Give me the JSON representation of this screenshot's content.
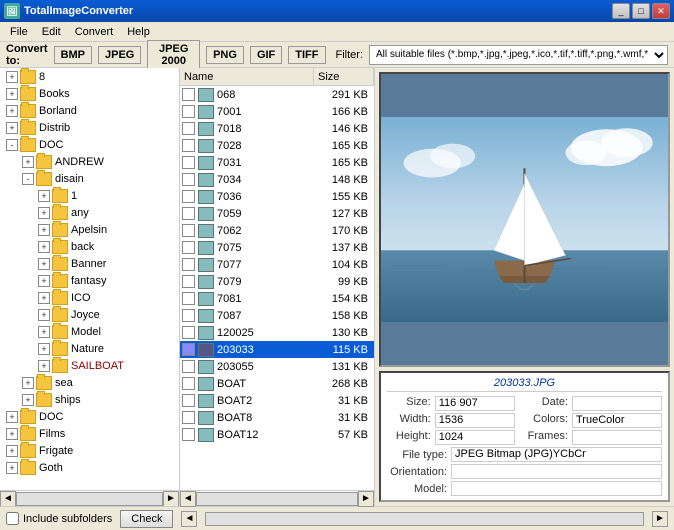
{
  "app": {
    "title": "TotalImageConverter",
    "icon": "🖼"
  },
  "title_buttons": {
    "minimize": "_",
    "maximize": "□",
    "close": "✕"
  },
  "menu": {
    "items": [
      "File",
      "Edit",
      "Convert",
      "Help"
    ]
  },
  "toolbar": {
    "convert_label": "Convert to:",
    "formats": [
      "BMP",
      "JPEG",
      "JPEG 2000",
      "PNG",
      "GIF",
      "TIFF"
    ],
    "filter_label": "Filter:",
    "filter_value": "All suitable files (*.bmp,*.jpg,*.jpeg,*.ico,*.tif,*.tiff,*.png,*.wmf,*"
  },
  "folder_tree": {
    "items": [
      {
        "label": "8",
        "indent": 0,
        "expanded": false
      },
      {
        "label": "Books",
        "indent": 0,
        "expanded": false
      },
      {
        "label": "Borland",
        "indent": 0,
        "expanded": false
      },
      {
        "label": "Distrib",
        "indent": 0,
        "expanded": false
      },
      {
        "label": "DOC",
        "indent": 0,
        "expanded": true
      },
      {
        "label": "ANDREW",
        "indent": 1,
        "expanded": false
      },
      {
        "label": "disain",
        "indent": 1,
        "expanded": true
      },
      {
        "label": "1",
        "indent": 2,
        "expanded": false
      },
      {
        "label": "any",
        "indent": 2,
        "expanded": false
      },
      {
        "label": "Apelsin",
        "indent": 2,
        "expanded": false
      },
      {
        "label": "back",
        "indent": 2,
        "expanded": false
      },
      {
        "label": "Banner",
        "indent": 2,
        "expanded": false
      },
      {
        "label": "fantasy",
        "indent": 2,
        "expanded": false
      },
      {
        "label": "ICO",
        "indent": 2,
        "expanded": false
      },
      {
        "label": "Joyce",
        "indent": 2,
        "expanded": false
      },
      {
        "label": "Model",
        "indent": 2,
        "expanded": false
      },
      {
        "label": "Nature",
        "indent": 2,
        "expanded": false
      },
      {
        "label": "SAILBOAT",
        "indent": 2,
        "expanded": false,
        "selected": false
      },
      {
        "label": "sea",
        "indent": 1,
        "expanded": false
      },
      {
        "label": "ships",
        "indent": 1,
        "expanded": false
      },
      {
        "label": "DOC",
        "indent": 0,
        "expanded": false
      },
      {
        "label": "Films",
        "indent": 0,
        "expanded": false
      },
      {
        "label": "Frigate",
        "indent": 0,
        "expanded": false
      },
      {
        "label": "Goth",
        "indent": 0,
        "expanded": false
      }
    ]
  },
  "file_list": {
    "headers": [
      "Name",
      "Size"
    ],
    "items": [
      {
        "name": "068",
        "size": "291 KB",
        "selected": false
      },
      {
        "name": "7001",
        "size": "166 KB",
        "selected": false
      },
      {
        "name": "7018",
        "size": "146 KB",
        "selected": false
      },
      {
        "name": "7028",
        "size": "165 KB",
        "selected": false
      },
      {
        "name": "7031",
        "size": "165 KB",
        "selected": false
      },
      {
        "name": "7034",
        "size": "148 KB",
        "selected": false
      },
      {
        "name": "7036",
        "size": "155 KB",
        "selected": false
      },
      {
        "name": "7059",
        "size": "127 KB",
        "selected": false
      },
      {
        "name": "7062",
        "size": "170 KB",
        "selected": false
      },
      {
        "name": "7075",
        "size": "137 KB",
        "selected": false
      },
      {
        "name": "7077",
        "size": "104 KB",
        "selected": false
      },
      {
        "name": "7079",
        "size": "99 KB",
        "selected": false
      },
      {
        "name": "7081",
        "size": "154 KB",
        "selected": false
      },
      {
        "name": "7087",
        "size": "158 KB",
        "selected": false
      },
      {
        "name": "120025",
        "size": "130 KB",
        "selected": false
      },
      {
        "name": "203033",
        "size": "115 KB",
        "selected": true
      },
      {
        "name": "203055",
        "size": "131 KB",
        "selected": false
      },
      {
        "name": "BOAT",
        "size": "268 KB",
        "selected": false
      },
      {
        "name": "BOAT2",
        "size": "31 KB",
        "selected": false
      },
      {
        "name": "BOAT8",
        "size": "31 KB",
        "selected": false
      },
      {
        "name": "BOAT12",
        "size": "57 KB",
        "selected": false
      }
    ]
  },
  "preview": {
    "filename": "203033.JPG"
  },
  "file_info": {
    "size_label": "Size:",
    "size_value": "116 907",
    "date_label": "Date:",
    "date_value": "",
    "width_label": "Width:",
    "width_value": "1536",
    "colors_label": "Colors:",
    "colors_value": "TrueColor",
    "height_label": "Height:",
    "height_value": "1024",
    "frames_label": "Frames:",
    "frames_value": "",
    "filetype_label": "File type:",
    "filetype_value": "JPEG Bitmap (JPG)YCbCr",
    "orientation_label": "Orientation:",
    "orientation_value": "",
    "model_label": "Model:",
    "model_value": ""
  },
  "status_bar": {
    "include_subfolders": "Include subfolders",
    "check_button": "Check",
    "arrow_left": "◄",
    "arrow_right": "►"
  }
}
